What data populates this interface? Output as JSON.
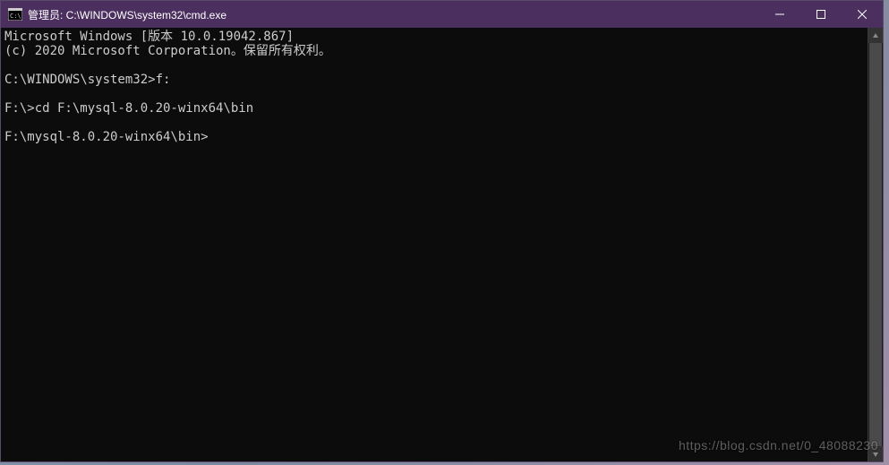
{
  "window": {
    "title": "管理员: C:\\WINDOWS\\system32\\cmd.exe"
  },
  "terminal": {
    "lines": [
      "Microsoft Windows [版本 10.0.19042.867]",
      "(c) 2020 Microsoft Corporation。保留所有权利。",
      "",
      "C:\\WINDOWS\\system32>f:",
      "",
      "F:\\>cd F:\\mysql-8.0.20-winx64\\bin",
      "",
      "F:\\mysql-8.0.20-winx64\\bin>"
    ]
  },
  "watermark": "https://blog.csdn.net/0_48088230"
}
